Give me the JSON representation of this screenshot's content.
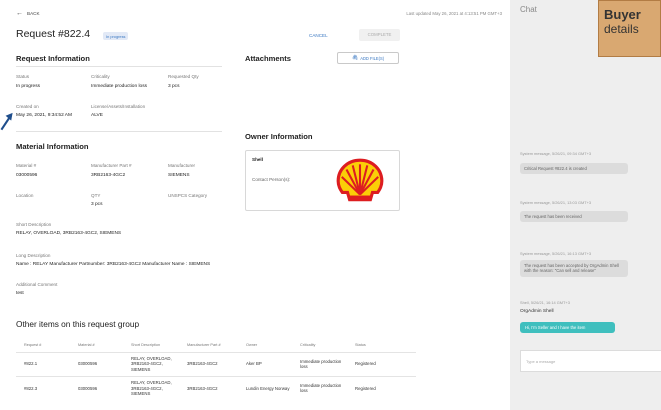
{
  "header": {
    "back": "BACK",
    "last_updated": "Last updated May 26, 2021 at 4:13:51 PM GMT+3",
    "title": "Request #822.4",
    "badge": "In progress",
    "cancel": "CANCEL",
    "complete": "COMPLETE"
  },
  "request_info": {
    "heading": "Request Information",
    "status_label": "Status",
    "status_value": "In progress",
    "criticality_label": "Criticality",
    "criticality_value": "Immediate production loss",
    "qty_label": "Requested Qty",
    "qty_value": "3 pcs",
    "created_label": "Created on",
    "created_value": "May 26, 2021, 9:34:52 AM",
    "license_label": "License/Assets/Installation",
    "license_value": "ALVE"
  },
  "attachments": {
    "heading": "Attachments",
    "add_files": "ADD FILE(S)"
  },
  "owner": {
    "heading": "Owner Information",
    "name": "Shell",
    "contact_label": "Contact Person(s):"
  },
  "material": {
    "heading": "Material Information",
    "material_label": "Material #",
    "material_value": "03000596",
    "mpn_label": "Manufacturer Part #",
    "mpn_value": "3RB2163-4GC2",
    "mfr_label": "Manufacturer",
    "mfr_value": "SIEMENS",
    "location_label": "Location",
    "qty_label": "QTY",
    "qty_value": "3 pcs",
    "unspsc_label": "UNSPCS Category",
    "short_desc_label": "Short Description",
    "short_desc_value": "RELAY, OVERLOAD, 3RB2163-4GC2, SIEMENS",
    "long_desc_label": "Long Description",
    "long_desc_value": "Name : RELAY Manufacturer Partnumber: 3RB2163-4GC2 Manufacturer Name : SIEMENS",
    "comment_label": "Additional Comment",
    "comment_value": "test"
  },
  "other_items": {
    "heading": "Other items on this request group",
    "columns": [
      "Request #",
      "Material #",
      "Short Description",
      "Manufacturer Part #",
      "Owner",
      "Criticality",
      "Status"
    ],
    "rows": [
      [
        "#822.1",
        "03000596",
        "RELAY, OVERLOAD, 3RB2163-4GC2, SIEMENS",
        "3RB2163-4GC2",
        "Aker BP",
        "Immediate production loss",
        "Registered"
      ],
      [
        "#822.3",
        "03000596",
        "RELAY, OVERLOAD, 3RB2163-4GC2, SIEMENS",
        "3RB2163-4GC2",
        "Lundin Energy Norway",
        "Immediate production loss",
        "Registered"
      ]
    ]
  },
  "chat": {
    "title": "Chat",
    "callout_bold": "Buyer",
    "callout_rest": "details",
    "messages": [
      {
        "meta": "System message, 5/26/21, 09:34 GMT+3",
        "text": "Critical Request #822.4 is created"
      },
      {
        "meta": "System message, 5/26/21, 13:03 GMT+3",
        "text": "The request has been received"
      },
      {
        "meta": "System message, 5/26/21, 16:13 GMT+3",
        "text": "The request has been accepted by OrgAdmin Shell with the reason: \"Can sell and release\""
      }
    ],
    "user_meta": "Shell, 5/26/21, 16:14 GMT+3",
    "user_name": "OrgAdmin Shell",
    "user_text": "Hi, I'm Seller and I have the item",
    "input_placeholder": "Type a message"
  },
  "colors": {
    "accent": "#3a78c2",
    "callout_bg": "#d9a871",
    "chat_bg": "#eeeeee",
    "user_bubble": "#3fbfbe",
    "shell_red": "#dd1d21",
    "shell_yellow": "#fbce07"
  },
  "icons": {
    "back": "arrow-left-icon",
    "attach": "paperclip-icon",
    "logo": "shell-logo-icon",
    "pointer": "arrow-pointer-icon"
  }
}
